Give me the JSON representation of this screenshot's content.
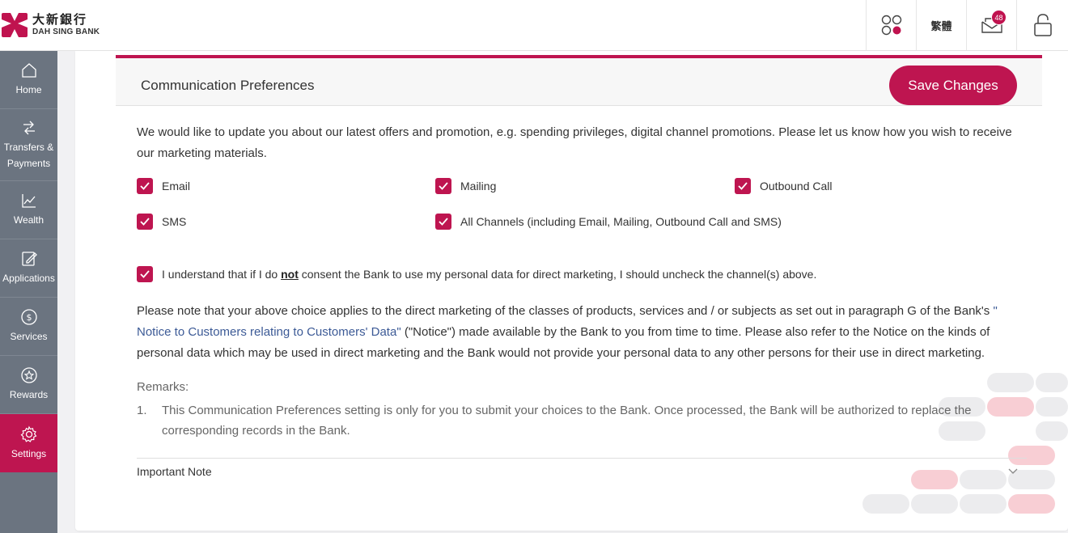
{
  "header": {
    "logo_cn": "大新銀行",
    "logo_en": "DAH SING BANK",
    "apps_icon": "apps-icon",
    "lang_label": "繁體",
    "mail_badge": "48",
    "lock_icon": "lock-icon"
  },
  "sidebar": {
    "items": [
      {
        "label": "Home",
        "icon": "home-icon"
      },
      {
        "label": "Transfers & Payments",
        "icon": "transfer-icon"
      },
      {
        "label": "Wealth",
        "icon": "chart-icon"
      },
      {
        "label": "Applications",
        "icon": "edit-icon"
      },
      {
        "label": "Services",
        "icon": "dollar-icon"
      },
      {
        "label": "Rewards",
        "icon": "star-icon"
      },
      {
        "label": "Settings",
        "icon": "gear-icon",
        "active": true
      }
    ]
  },
  "section": {
    "title": "Communication Preferences",
    "save_label": "Save Changes"
  },
  "intro": "We would like to update you about our latest offers and promotion, e.g. spending privileges, digital channel promotions. Please let us know how you wish to receive our marketing materials.",
  "channels": [
    {
      "label": "Email",
      "checked": true
    },
    {
      "label": "Mailing",
      "checked": true
    },
    {
      "label": "Outbound Call",
      "checked": true
    },
    {
      "label": "SMS",
      "checked": true
    },
    {
      "label": "All Channels (including Email, Mailing, Outbound Call and SMS)",
      "checked": true
    }
  ],
  "consent": {
    "before": "I understand that if I do ",
    "emph": "not",
    "after": " consent the Bank to use my personal data for direct marketing, I should uncheck the channel(s) above.",
    "checked": true
  },
  "notice": {
    "part1": "Please note that your above choice applies to the direct marketing of the classes of products, services and / or subjects as set out in paragraph G of the Bank's ",
    "link": "\" Notice to Customers relating to Customers' Data\"",
    "part2": " (\"Notice\") made available by the Bank to you from time to time. Please also refer to the Notice on the kinds of personal data which may be used in direct marketing and the Bank would not provide your personal data to any other persons for their use in direct marketing."
  },
  "remarks": {
    "title": "Remarks:",
    "items": [
      {
        "num": "1.",
        "text": "This Communication Preferences setting is only for you to submit your choices to the Bank. Once processed, the Bank will be authorized to replace the corresponding records in the Bank."
      }
    ]
  },
  "important_note": "Important Note",
  "colors": {
    "brand": "#be1550",
    "sidebar": "#6b7480",
    "link": "#3c5a96"
  }
}
